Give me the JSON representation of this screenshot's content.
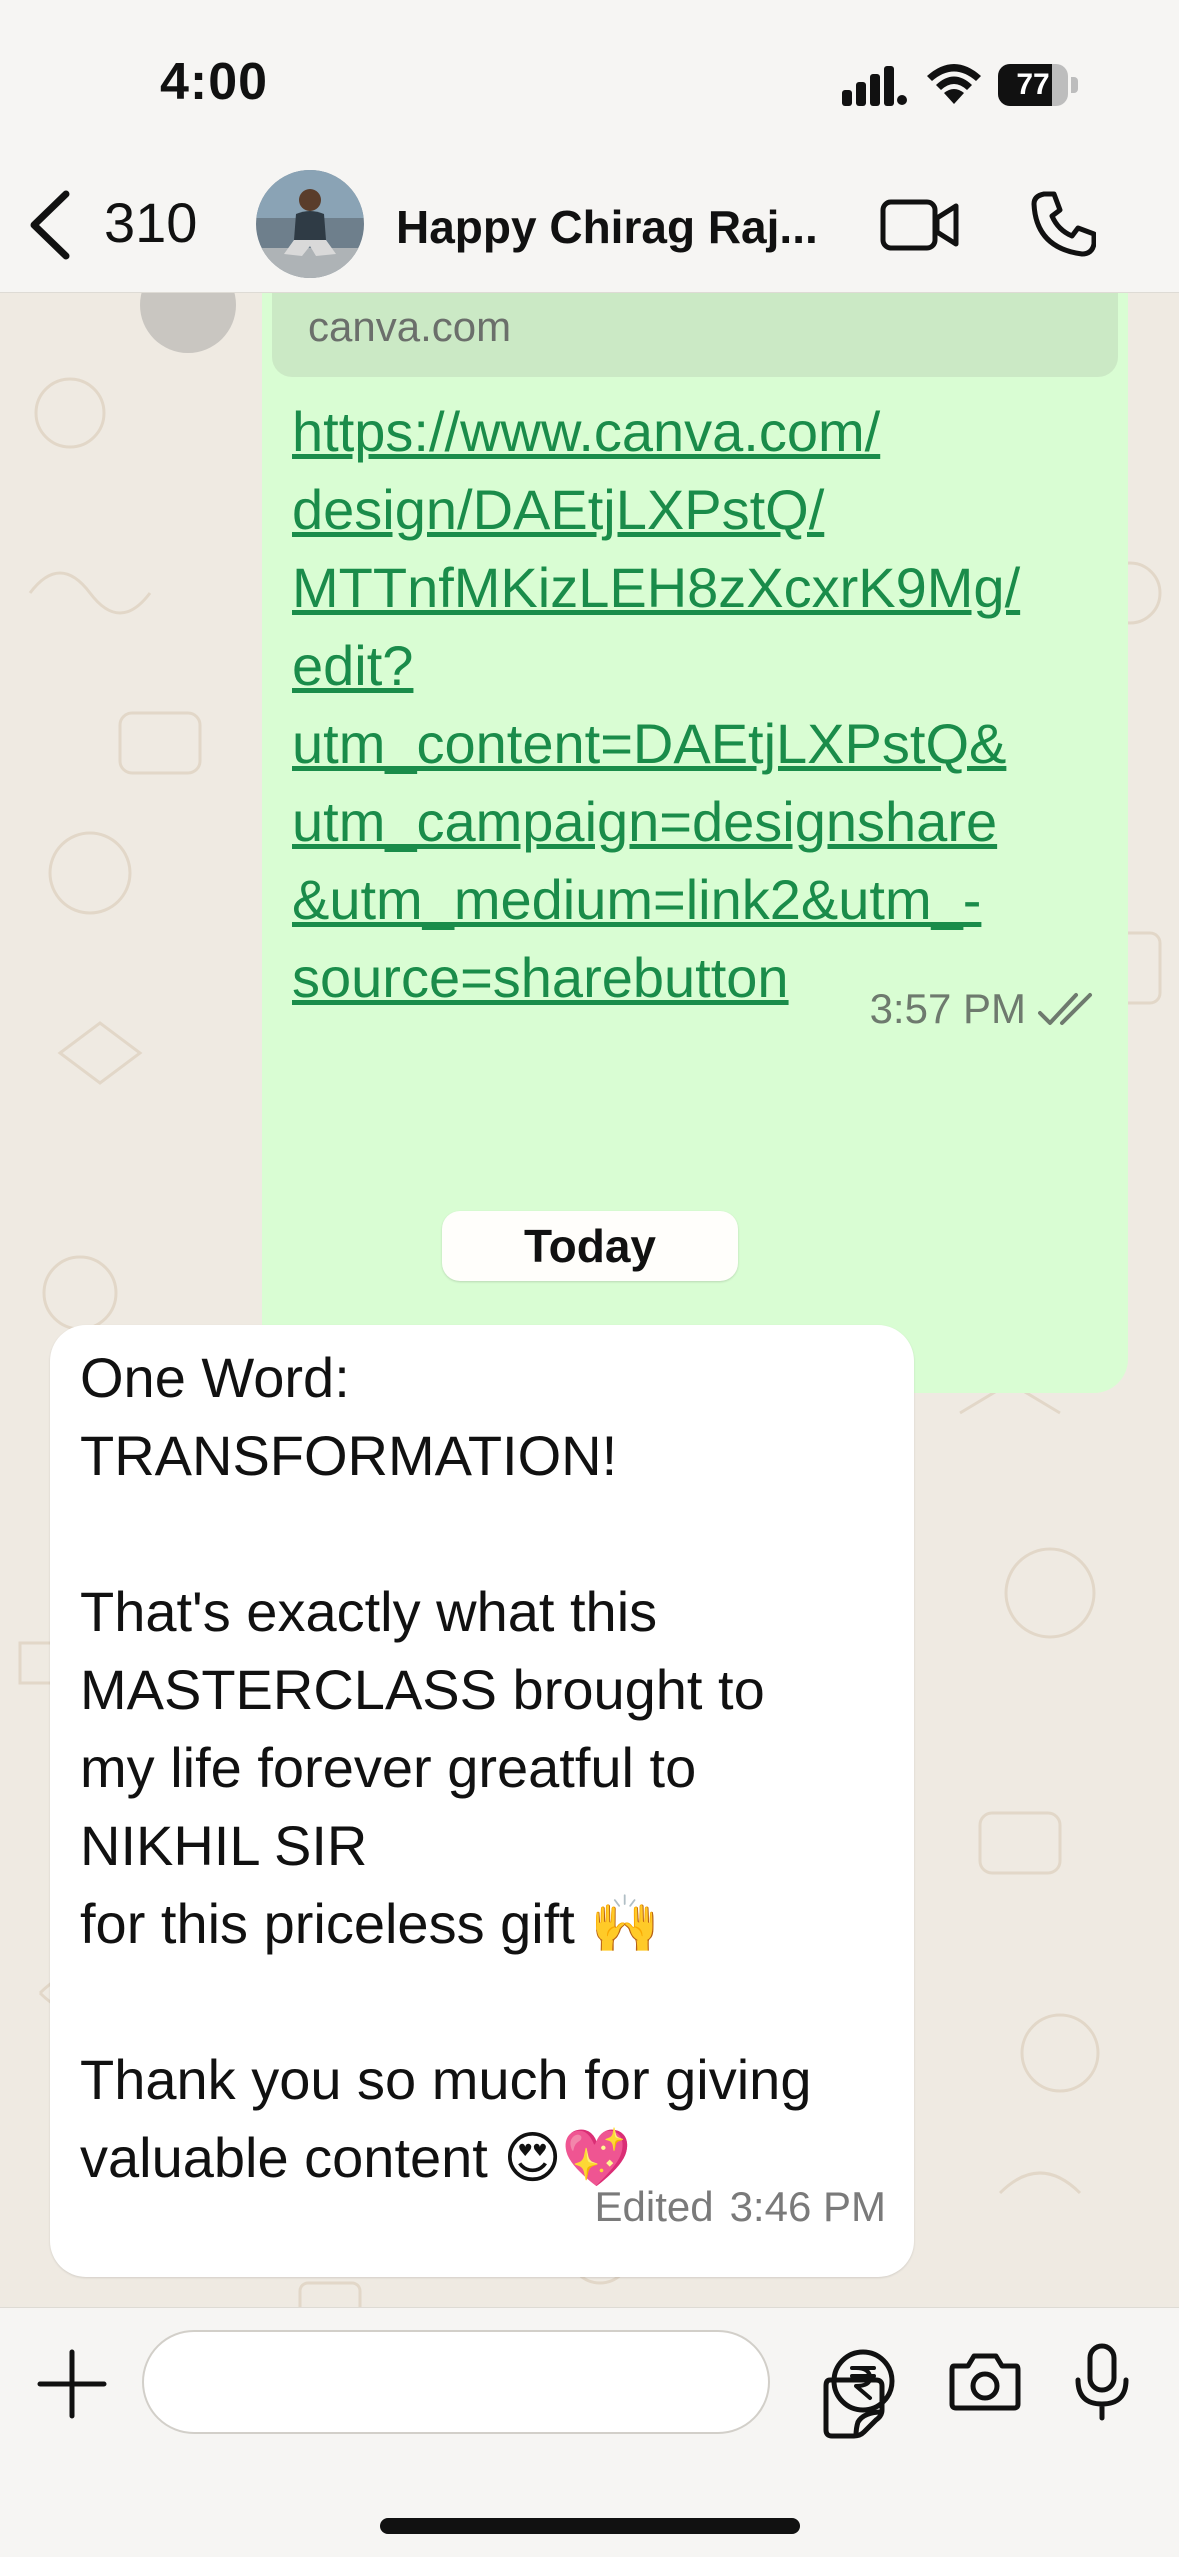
{
  "status_bar": {
    "time": "4:00",
    "battery_percent": "77",
    "battery_level": 0.77
  },
  "header": {
    "unread_count": "310",
    "contact_name": "Happy Chirag Raj...",
    "icons": [
      "back-chevron-icon",
      "avatar",
      "video-call-icon",
      "phone-icon"
    ]
  },
  "messages": {
    "outgoing": {
      "link_domain": "canva.com",
      "url_text": "https://www.canva.com/\ndesign/DAEtjLXPstQ/\nMTTnfMKizLEH8zXcxrK9Mg/\nedit?\nutm_content=DAEtjLXPstQ&\nutm_campaign=designshare\n&utm_medium=link2&utm_-\nsource=sharebutton",
      "time": "3:57 PM",
      "status_icon": "double-check-icon"
    },
    "date_separator": "Today",
    "incoming": {
      "text": "One Word:\nTRANSFORMATION!\n\nThat's exactly what this\nMASTERCLASS brought to\nmy life forever greatful to\nNIKHIL SIR\nfor this priceless gift 🙌\n\nThank you so much for giving\nvaluable content 😍💖",
      "edited_label": "Edited",
      "time": "3:46 PM"
    }
  },
  "input_bar": {
    "placeholder": "",
    "icons": [
      "plus-icon",
      "sticker-icon",
      "rupee-payment-icon",
      "camera-icon",
      "microphone-icon"
    ]
  },
  "colors": {
    "outgoing_bubble": "#d9fdd3",
    "link": "#1a8c4a",
    "chat_background": "#efeae2",
    "incoming_bubble": "#ffffff"
  }
}
